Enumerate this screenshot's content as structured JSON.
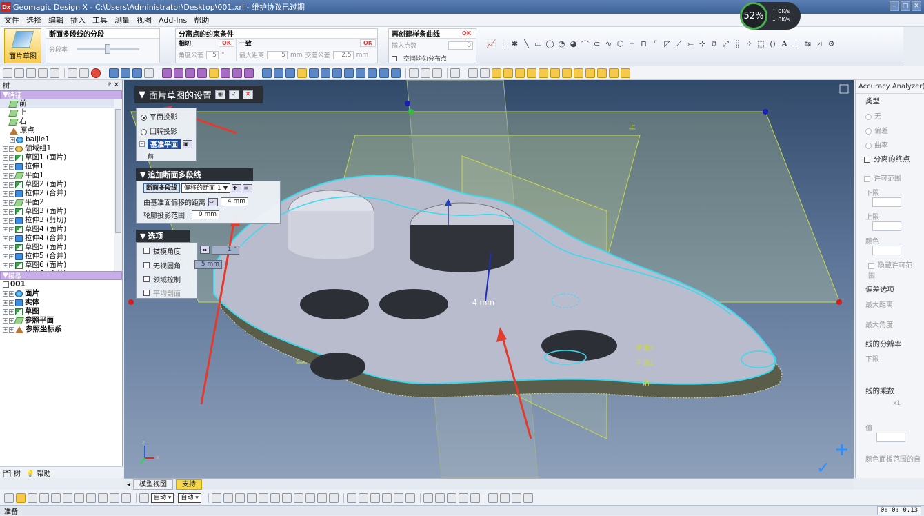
{
  "window": {
    "app_badge": "Dx",
    "title": "Geomagic Design X - C:\\Users\\Administrator\\Desktop\\001.xrl - 维护协议已过期"
  },
  "perf": {
    "percent": "52%",
    "up": "0K/s",
    "down": "0K/s"
  },
  "menu": [
    "文件",
    "选择",
    "编辑",
    "插入",
    "工具",
    "测量",
    "视图",
    "Add-Ins",
    "帮助"
  ],
  "ribbon": {
    "sketch_button": "面片草图",
    "group1": {
      "title": "断面多段线的分段",
      "row_label": "分段率"
    },
    "group2": {
      "title": "分离点的约束条件",
      "tangent": {
        "title": "相切",
        "ok": "OK",
        "label": "角度公差",
        "value": "5",
        "unit": "°"
      },
      "coincide": {
        "title": "一致",
        "ok": "OK",
        "label1": "最大距离",
        "value1": "5",
        "unit1": "mm",
        "label2": "交差公差",
        "value2": "2.5",
        "unit2": "mm"
      }
    },
    "group3": {
      "title": "再创建样条曲线",
      "ok": "OK",
      "label": "插入点数",
      "value": "0",
      "check_label": "空间均匀分布点"
    }
  },
  "tree_panel": {
    "title": "树",
    "pin": "ᵖ",
    "close": "✕",
    "features_header": "特征",
    "features": [
      {
        "label": "前",
        "icon": "plane",
        "level": 1
      },
      {
        "label": "上",
        "icon": "plane",
        "level": 1
      },
      {
        "label": "右",
        "icon": "plane",
        "level": 1
      },
      {
        "label": "原点",
        "icon": "origin",
        "level": 1
      },
      {
        "label": "baijie1",
        "icon": "mesh",
        "level": 1
      },
      {
        "label": "领域组1",
        "icon": "region",
        "level": 0
      },
      {
        "label": "草图1 (面片)",
        "icon": "sketch",
        "level": 0
      },
      {
        "label": "拉伸1",
        "icon": "extrude",
        "level": 0
      },
      {
        "label": "平面1",
        "icon": "plane",
        "level": 0
      },
      {
        "label": "草图2 (面片)",
        "icon": "sketch",
        "level": 0
      },
      {
        "label": "拉伸2 (合并)",
        "icon": "extrude",
        "level": 0
      },
      {
        "label": "平面2",
        "icon": "plane",
        "level": 0
      },
      {
        "label": "草图3 (面片)",
        "icon": "sketch",
        "level": 0
      },
      {
        "label": "拉伸3 (剪切)",
        "icon": "extrude",
        "level": 0
      },
      {
        "label": "草图4 (面片)",
        "icon": "sketch",
        "level": 0
      },
      {
        "label": "拉伸4 (合并)",
        "icon": "extrude",
        "level": 0
      },
      {
        "label": "草图5 (面片)",
        "icon": "sketch",
        "level": 0
      },
      {
        "label": "拉伸5 (合并)",
        "icon": "extrude",
        "level": 0
      },
      {
        "label": "草图6 (面片)",
        "icon": "sketch",
        "level": 0
      },
      {
        "label": "拉伸6 (合并)",
        "icon": "extrude",
        "level": 0
      }
    ],
    "model_header": "模型",
    "model_root": "001",
    "model_items": [
      "面片",
      "实体",
      "草图",
      "参照平面",
      "参照坐标系"
    ],
    "footer": {
      "tree_tab": "树",
      "help_tab": "帮助"
    }
  },
  "feature_panel": {
    "title": "面片草图的设置",
    "projection": {
      "option1": "平面投影",
      "option2": "回转投影",
      "base_plane_label": "基准平面",
      "base_plane_value": "前"
    },
    "section": {
      "title": "追加断面多段线",
      "mode_button": "断面多段线",
      "select_value": "偏移的断面 1",
      "offset_label": "由基准面偏移的距离",
      "offset_value": "4 mm",
      "range_label": "轮廓投影范围",
      "range_value": "0 mm"
    },
    "options": {
      "title": "选项",
      "draft_label": "拔模角度",
      "draft_value": "1 °",
      "fillet_label": "无视圆角",
      "fillet_value": "5 mm",
      "region_label": "领域控制",
      "average_label": "平均剖面"
    }
  },
  "viewport": {
    "dimension_label": "4 mm",
    "plane_labels": [
      "上",
      "平面2",
      "平面1",
      "前"
    ],
    "axes": {
      "x": "x",
      "z": "z"
    },
    "colors": {
      "outline": "#3ad9f0",
      "plane_edge": "#c9d84a",
      "arrow": "#e23b2e",
      "part_top": "#b8bccd",
      "part_side": "#6a6e5a"
    }
  },
  "right_panel": {
    "title": "Accuracy Analyzer(TM)",
    "type_label": "类型",
    "type_options": [
      "无",
      "偏差",
      "曲率"
    ],
    "separate_endpoint": "分离的终点",
    "tolerance_label": "许可范围",
    "lower": "下限",
    "upper": "上限",
    "color": "颜色",
    "hide_tolerance": "隐藏许可范围",
    "deviation_options": "偏差选项",
    "max_distance": "最大距离",
    "max_angle": "最大角度",
    "line_resolution": "线的分辨率",
    "lower2": "下限",
    "line_multiplier": "线的乘数",
    "x1": "x1",
    "value_label": "值",
    "color_bar_label": "颜色面板范围的自"
  },
  "bottom_tabs": [
    "模型视图",
    "支持"
  ],
  "status": {
    "text": "准备",
    "coords": "0: 0: 0.13"
  }
}
